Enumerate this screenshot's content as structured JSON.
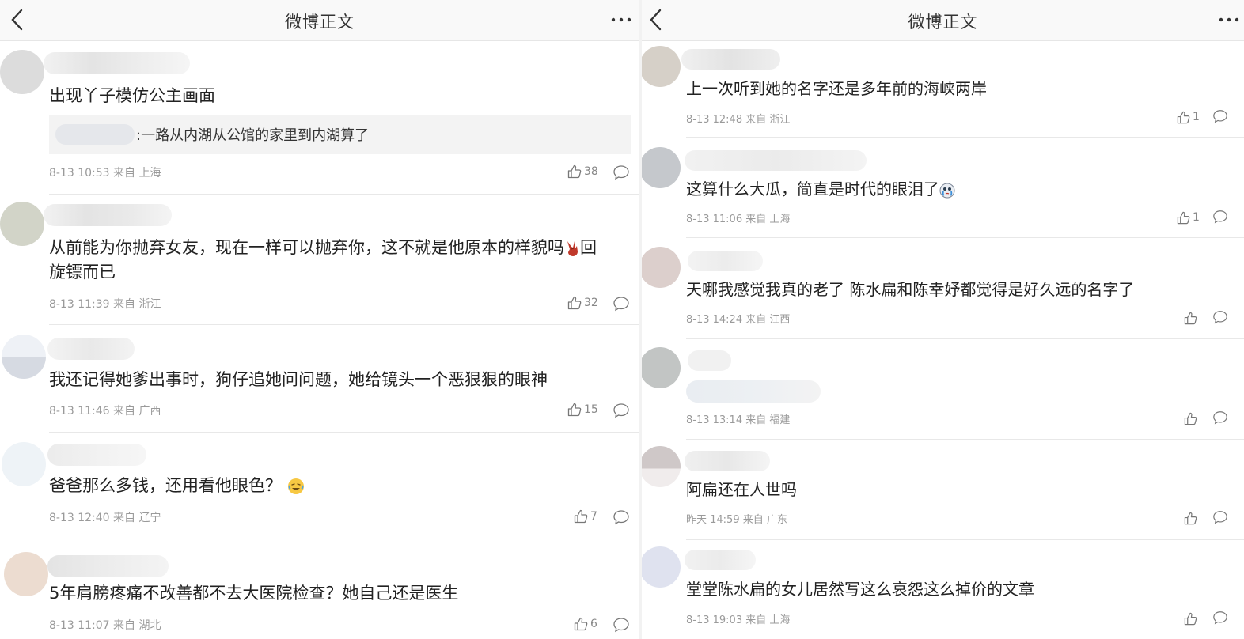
{
  "left": {
    "nav": {
      "title": "微博正文"
    },
    "comments": [
      {
        "text": "出现丫子模仿公主画面",
        "quote": ":一路从内湖从公馆的家里到内湖算了",
        "time": "8-13 10:53",
        "source": "来自",
        "location": "上海",
        "likes": "38"
      },
      {
        "text": "从前能为你抛弃女友，现在一样可以抛弃你，这不就是他原本的样貌吗",
        "text_tail": "回",
        "text2": "旋镖而已",
        "time": "8-13 11:39",
        "source": "来自",
        "location": "浙江",
        "likes": "32"
      },
      {
        "text": "我还记得她爹出事时，狗仔追她问问题，她给镜头一个恶狠狠的眼神",
        "time": "8-13 11:46",
        "source": "来自",
        "location": "广西",
        "likes": "15"
      },
      {
        "text": "爸爸那么多钱，还用看他眼色？",
        "time": "8-13 12:40",
        "source": "来自",
        "location": "辽宁",
        "likes": "7"
      },
      {
        "text": "5年肩膀疼痛不改善都不去大医院检查？她自己还是医生",
        "time": "8-13 11:07",
        "source": "来自",
        "location": "湖北",
        "likes": "6"
      }
    ]
  },
  "right": {
    "nav": {
      "title": "微博正文"
    },
    "comments": [
      {
        "text": "上一次听到她的名字还是多年前的海峡两岸",
        "time": "8-13 12:48",
        "source": "来自",
        "location": "浙江",
        "likes": "1"
      },
      {
        "text": "这算什么大瓜，简直是时代的眼泪了",
        "time": "8-13 11:06",
        "source": "来自",
        "location": "上海",
        "likes": "1"
      },
      {
        "text": "天哪我感觉我真的老了 陈水扁和陈幸妤都觉得是好久远的名字了",
        "time": "8-13 14:24",
        "source": "来自",
        "location": "江西",
        "likes": ""
      },
      {
        "text": "",
        "time": "8-13 13:14",
        "source": "来自",
        "location": "福建",
        "likes": ""
      },
      {
        "text": "阿扁还在人世吗",
        "time": "昨天 14:59",
        "source": "来自",
        "location": "广东",
        "likes": ""
      },
      {
        "text": "堂堂陈水扁的女儿居然写这么哀怨这么掉价的文章",
        "time": "8-13 19:03",
        "source": "来自",
        "location": "上海",
        "likes": ""
      }
    ]
  },
  "icons": {
    "back": "chevron-left-icon",
    "more": "more-icon",
    "like": "thumb-up-icon",
    "reply": "comment-bubble-icon",
    "emoji_rock": "rock-hand-emoji-icon",
    "emoji_tears": "tears-emoji-icon",
    "emoji_laugh": "laugh-cry-emoji-icon"
  },
  "colors": {
    "nav_bg": "#f9f9f9",
    "text": "#222222",
    "meta": "#9a9a9a",
    "quote_bg": "#f3f3f3"
  }
}
